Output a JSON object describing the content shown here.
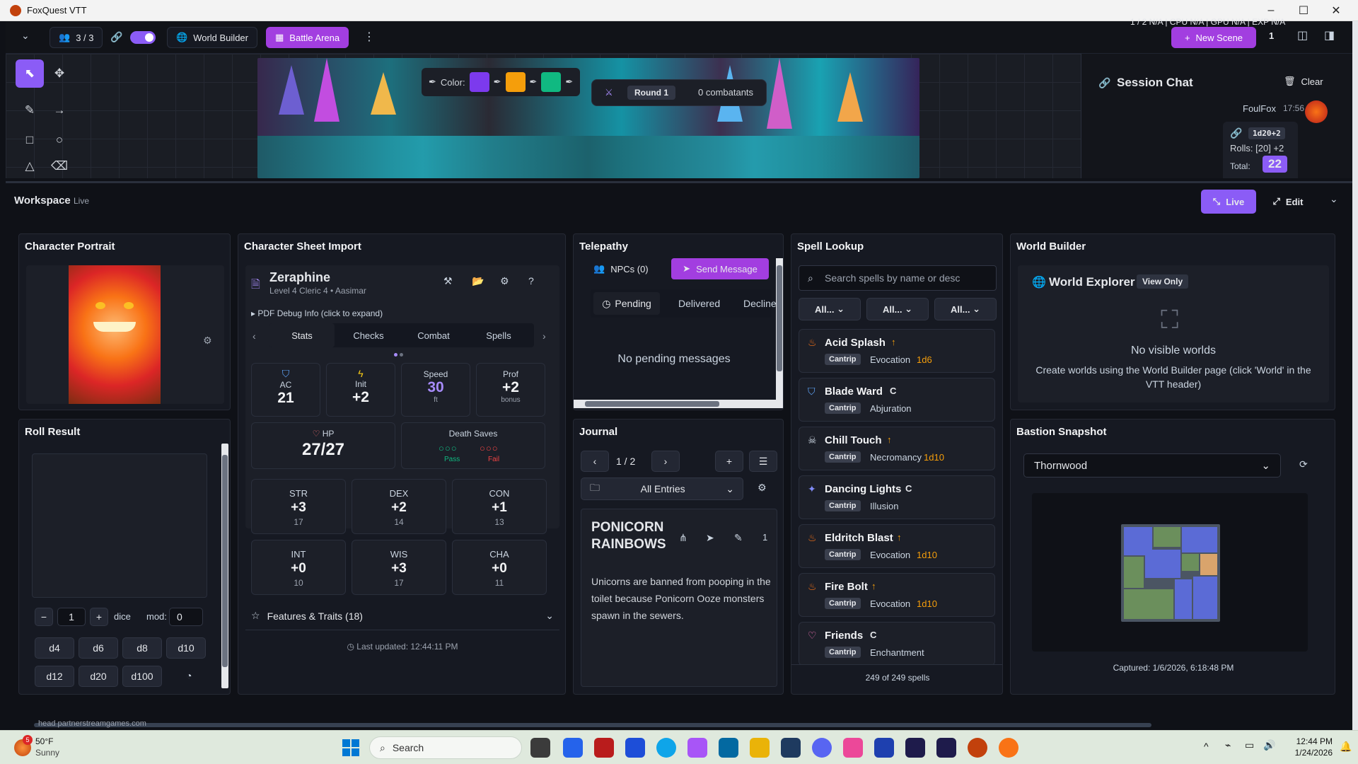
{
  "window": {
    "title": "FoxQuest VTT",
    "minimize": "–",
    "maximize": "☐",
    "close": "✕"
  },
  "topbar": {
    "players": "3 / 3",
    "world_builder": "World Builder",
    "battle_arena": "Battle Arena",
    "new_scene": "New Scene",
    "scene_count": "1",
    "hidden_stats": "1 / 2   N/A   |   CPU   N/A   |   GPU   N/A   |   EXP  N/A"
  },
  "canvas": {
    "color_label": "Color:",
    "colors": [
      "#7c3aed",
      "#f59e0b",
      "#10b981"
    ],
    "round": "Round 1",
    "combatants": "0 combatants"
  },
  "chat": {
    "title": "Session Chat",
    "clear": "Clear",
    "user": "FoulFox",
    "time": "17:56",
    "roll_formula": "1d20+2",
    "rolls": "Rolls: [20] +2",
    "total_label": "Total:",
    "total": "22"
  },
  "workspace": {
    "title": "Workspace",
    "status": "Live",
    "live_btn": "Live",
    "edit_btn": "Edit"
  },
  "portrait": {
    "title": "Character Portrait"
  },
  "roll": {
    "title": "Roll Result",
    "count": "1",
    "dice_label": "dice",
    "mod_label": "mod:",
    "mod": "0",
    "dice": [
      "d4",
      "d6",
      "d8",
      "d10",
      "d12",
      "d20",
      "d100"
    ]
  },
  "sheet": {
    "title": "Character Sheet Import",
    "name": "Zeraphine",
    "subtitle": "Level 4 Cleric 4 • Aasimar",
    "debug": "▸ PDF Debug Info (click to expand)",
    "tabs": [
      "Stats",
      "Checks",
      "Combat",
      "Spells"
    ],
    "ac_label": "AC",
    "ac": "21",
    "init_label": "Init",
    "init": "+2",
    "speed_label": "Speed",
    "speed": "30",
    "speed_unit": "ft",
    "prof_label": "Prof",
    "prof": "+2",
    "prof_unit": "bonus",
    "hp_label": "HP",
    "hp": "27/27",
    "death_label": "Death Saves",
    "pass": "Pass",
    "fail": "Fail",
    "abilities": [
      {
        "n": "STR",
        "m": "+3",
        "s": "17"
      },
      {
        "n": "DEX",
        "m": "+2",
        "s": "14"
      },
      {
        "n": "CON",
        "m": "+1",
        "s": "13"
      },
      {
        "n": "INT",
        "m": "+0",
        "s": "10"
      },
      {
        "n": "WIS",
        "m": "+3",
        "s": "17"
      },
      {
        "n": "CHA",
        "m": "+0",
        "s": "11"
      }
    ],
    "features": "Features & Traits (18)",
    "updated": "Last updated: 12:44:11 PM"
  },
  "telepathy": {
    "title": "Telepathy",
    "npcs": "NPCs (0)",
    "send": "Send Message",
    "tabs": [
      "Pending",
      "Delivered",
      "Declined"
    ],
    "empty": "No pending messages"
  },
  "journal": {
    "title": "Journal",
    "page": "1 / 2",
    "filter": "All Entries",
    "entry_title": "PONICORN RAINBOWS",
    "entry_count": "1",
    "entry_body": "Unicorns are banned from pooping in the toilet because Ponicorn Ooze monsters spawn in the sewers."
  },
  "spells": {
    "title": "Spell Lookup",
    "placeholder": "Search spells by name or desc",
    "filters": [
      "All...",
      "All...",
      "All..."
    ],
    "count": "249 of 249 spells",
    "list": [
      {
        "name": "Acid Splash",
        "tag": "Cantrip",
        "school": "Evocation",
        "dice": "1d6",
        "mark": "↑",
        "icon": "flame-icon"
      },
      {
        "name": "Blade Ward",
        "tag": "Cantrip",
        "school": "Abjuration",
        "dice": "",
        "mark": "C",
        "icon": "shield-icon"
      },
      {
        "name": "Chill Touch",
        "tag": "Cantrip",
        "school": "Necromancy",
        "dice": "1d10",
        "mark": "↑",
        "icon": "skull-icon"
      },
      {
        "name": "Dancing Lights",
        "tag": "Cantrip",
        "school": "Illusion",
        "dice": "",
        "mark": "C",
        "icon": "sparkle-icon"
      },
      {
        "name": "Eldritch Blast",
        "tag": "Cantrip",
        "school": "Evocation",
        "dice": "1d10",
        "mark": "↑",
        "icon": "flame-icon"
      },
      {
        "name": "Fire Bolt",
        "tag": "Cantrip",
        "school": "Evocation",
        "dice": "1d10",
        "mark": "↑",
        "icon": "flame-icon"
      },
      {
        "name": "Friends",
        "tag": "Cantrip",
        "school": "Enchantment",
        "dice": "",
        "mark": "C",
        "icon": "heart-icon"
      }
    ]
  },
  "world": {
    "title": "World Builder",
    "explorer": "World Explorer",
    "view_only": "View Only",
    "empty_title": "No visible worlds",
    "empty_body": "Create worlds using the World Builder page (click 'World' in the VTT header)"
  },
  "bastion": {
    "title": "Bastion Snapshot",
    "selected": "Thornwood",
    "captured": "Captured: 1/6/2026, 6:18:48 PM"
  },
  "taskbar": {
    "temp": "50°F",
    "weather": "Sunny",
    "search": "Search",
    "time": "12:44 PM",
    "date": "1/24/2026",
    "url": "head partnerstreamgames.com",
    "badge": "5"
  }
}
